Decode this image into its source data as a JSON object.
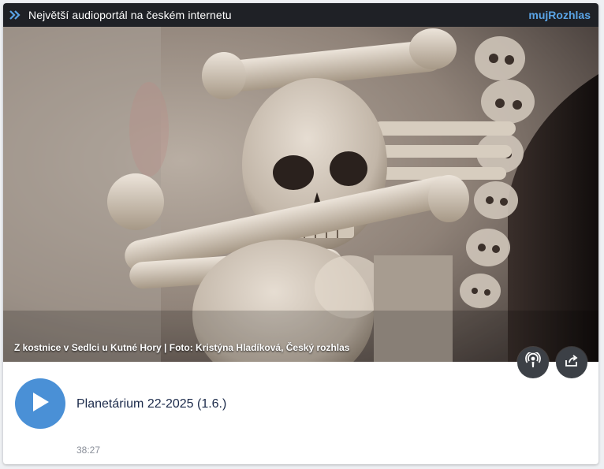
{
  "topbar": {
    "tagline": "Největší audioportál na českém internetu",
    "brand": "mujRozhlas",
    "brand_color": "#5aa4e6"
  },
  "hero": {
    "caption": "Z kostnice v Sedlci u Kutné Hory | Foto: Kristýna Hladíková, Český rozhlas"
  },
  "actions": {
    "podcast_icon": "podcast-icon",
    "share_icon": "share-icon"
  },
  "episode": {
    "title": "Planetárium 22-2025 (1.6.)",
    "duration": "38:27",
    "play_icon": "play-icon",
    "accent": "#4a90d6"
  }
}
